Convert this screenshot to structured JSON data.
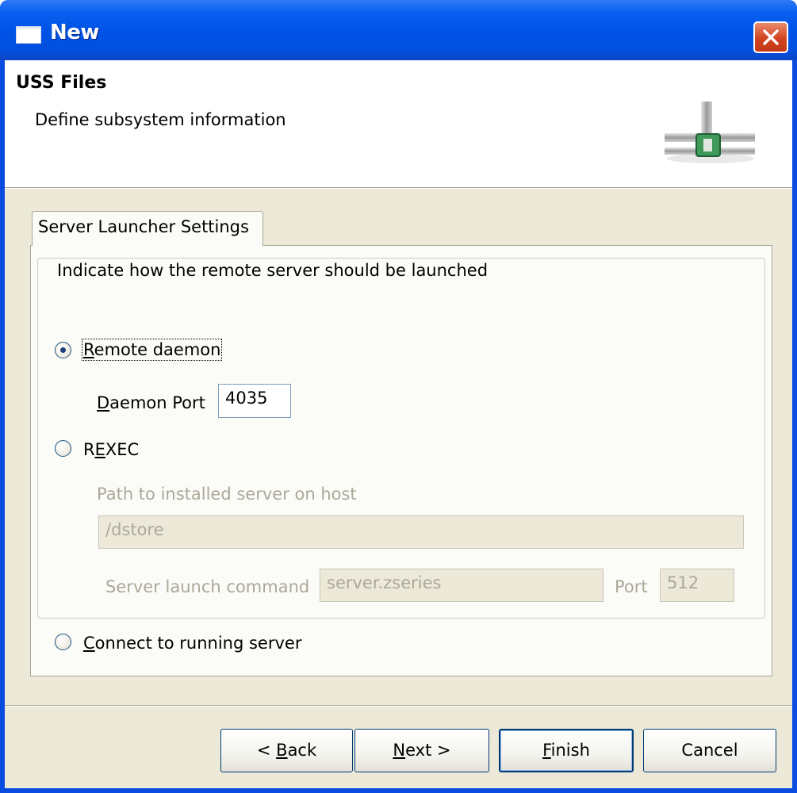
{
  "window": {
    "title": "New"
  },
  "banner": {
    "title": "USS Files",
    "description": "Define subsystem information"
  },
  "tab": {
    "label": "Server Launcher Settings"
  },
  "group": {
    "legend": "Indicate how the remote server should be launched"
  },
  "options": {
    "remote_daemon": {
      "label": "Remote daemon",
      "selected": true
    },
    "rexec": {
      "label": "REXEC",
      "selected": false
    },
    "connect_running": {
      "label": "Connect to running server",
      "selected": false
    }
  },
  "daemon_port": {
    "label": "Daemon Port",
    "value": "4035"
  },
  "rexec_settings": {
    "path_label": "Path to installed server on host",
    "path_value": "/dstore",
    "command_label": "Server launch command",
    "command_value": "server.zseries",
    "port_label": "Port",
    "port_value": "512"
  },
  "buttons": {
    "back": "< Back",
    "next": "Next >",
    "finish": "Finish",
    "cancel": "Cancel"
  },
  "colors": {
    "titlebar": "#0054e3",
    "dialog_bg": "#ece9d8",
    "panel_bg": "#fbfbf8",
    "close_button": "#d3431f",
    "disabled_text": "#aca899"
  },
  "icons": {
    "title": "window-icon",
    "close": "close-x-icon",
    "banner": "network-connector-icon"
  }
}
